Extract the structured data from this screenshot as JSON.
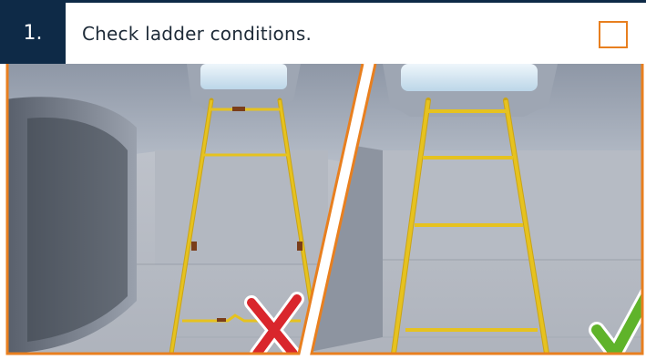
{
  "step": {
    "number": "1.",
    "instruction": "Check ladder conditions."
  },
  "checkbox": {
    "checked": false,
    "border_color": "#e87f1f"
  },
  "colors": {
    "header_dark": "#0e2a47",
    "accent_orange": "#e87f1f",
    "ladder_yellow": "#e6c21f",
    "wrong_red": "#d9262c",
    "correct_green": "#5fb32a"
  },
  "illustrations": [
    {
      "state": "incorrect",
      "icon": "red-x-icon"
    },
    {
      "state": "correct",
      "icon": "green-check-icon"
    }
  ]
}
